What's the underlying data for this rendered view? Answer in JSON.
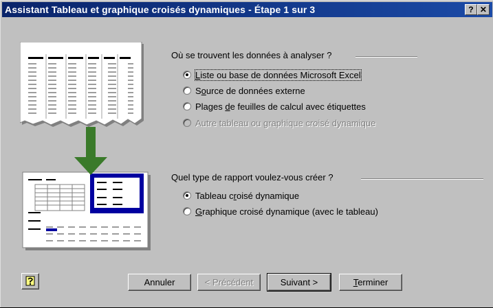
{
  "window": {
    "title": "Assistant Tableau et graphique croisés dynamiques - Étape 1 sur 3",
    "help_button": "?",
    "close_button": "✕"
  },
  "source_group": {
    "label": "Où se trouvent les données à analyser ?",
    "options": [
      {
        "pre": "",
        "key": "L",
        "post": "iste ou base de données Microsoft Excel",
        "checked": true,
        "enabled": true
      },
      {
        "pre": "S",
        "key": "o",
        "post": "urce de données externe",
        "checked": false,
        "enabled": true
      },
      {
        "pre": "Plages ",
        "key": "d",
        "post": "e feuilles de calcul avec étiquettes",
        "checked": false,
        "enabled": true
      },
      {
        "pre": "",
        "key": "A",
        "post": "utre tableau ou graphique croisé dynamique",
        "checked": false,
        "enabled": false
      }
    ]
  },
  "report_group": {
    "label": "Quel type de rapport voulez-vous créer ?",
    "options": [
      {
        "pre": "Tableau c",
        "key": "r",
        "post": "oisé dynamique",
        "checked": true,
        "enabled": true
      },
      {
        "pre": "",
        "key": "G",
        "post": "raphique croisé dynamique (avec le tableau)",
        "checked": false,
        "enabled": true
      }
    ]
  },
  "buttons": {
    "cancel": "Annuler",
    "previous": "< Précédent",
    "next": "Suivant >",
    "finish_pre": "",
    "finish_key": "T",
    "finish_post": "erminer"
  },
  "icons": {
    "help": "office-assistant-icon",
    "illustration_top": "data-list-illustration",
    "illustration_bottom": "pivot-table-illustration",
    "arrow": "down-arrow-icon"
  },
  "colors": {
    "titlebar": "#0a246a",
    "face": "#c0c0c0",
    "arrow": "#3a7a2a",
    "pivot_blue": "#0000a0"
  }
}
